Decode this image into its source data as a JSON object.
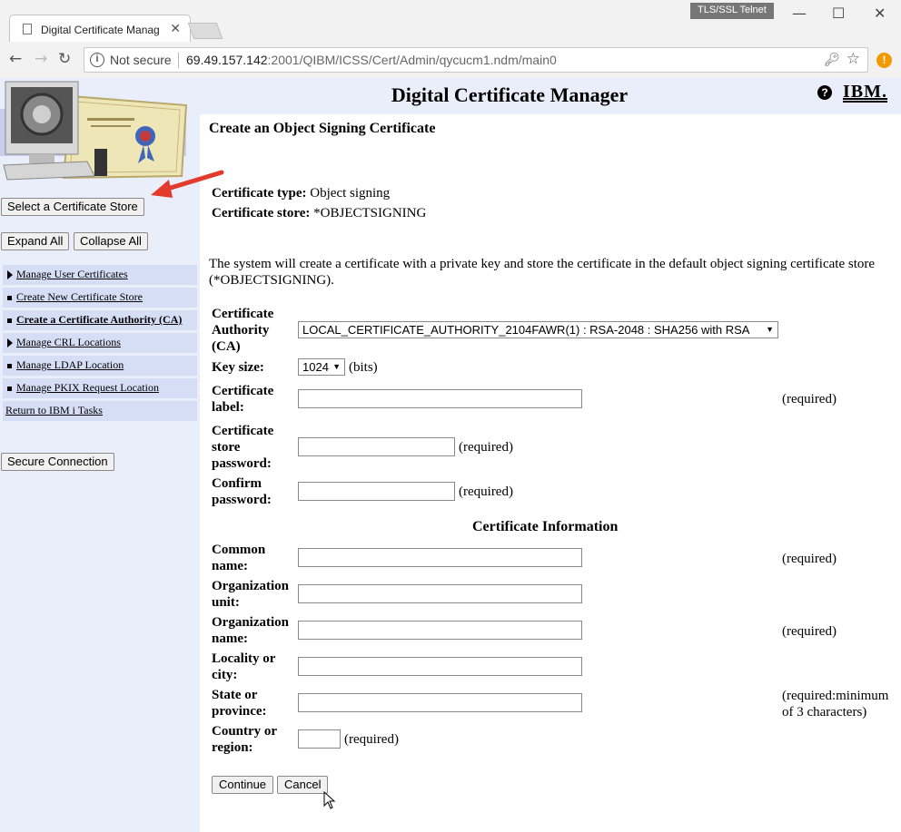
{
  "browser": {
    "tab_title": "Digital Certificate Manag",
    "tls_badge": "TLS/SSL Telnet",
    "security_label": "Not secure",
    "url_host": "69.49.157.142",
    "url_rest": ":2001/QIBM/ICSS/Cert/Admin/qycucm1.ndm/main0"
  },
  "header": {
    "app_title": "Digital Certificate Manager",
    "ibm_logo": "IBM."
  },
  "sidebar": {
    "select_store_button": "Select a Certificate Store",
    "expand_all": "Expand All",
    "collapse_all": "Collapse All",
    "items": [
      {
        "label": "Manage User Certificates",
        "marker": "triangle"
      },
      {
        "label": "Create New Certificate Store",
        "marker": "square"
      },
      {
        "label": "Create a Certificate Authority (CA)",
        "marker": "square",
        "active": true
      },
      {
        "label": "Manage CRL Locations",
        "marker": "triangle"
      },
      {
        "label": "Manage LDAP Location",
        "marker": "square"
      },
      {
        "label": "Manage PKIX Request Location",
        "marker": "square"
      },
      {
        "label": "Return to IBM i Tasks",
        "marker": "none"
      }
    ],
    "secure_connection": "Secure Connection"
  },
  "main": {
    "page_title": "Create an Object Signing Certificate",
    "cert_type_label": "Certificate type:",
    "cert_type_value": "Object signing",
    "cert_store_label": "Certificate store:",
    "cert_store_value": "*OBJECTSIGNING",
    "description": "The system will create a certificate with a private key and store the certificate in the default object signing certificate store (*OBJECTSIGNING).",
    "ca_label": "Certificate Authority (CA)",
    "ca_value": "LOCAL_CERTIFICATE_AUTHORITY_2104FAWR(1) : RSA-2048 : SHA256 with RSA",
    "keysize_label": "Key size:",
    "keysize_value": "1024",
    "keysize_unit": "(bits)",
    "label_label": "Certificate label:",
    "store_pw_label": "Certificate store password:",
    "confirm_pw_label": "Confirm password:",
    "section_title": "Certificate Information",
    "common_name_label": "Common name:",
    "org_unit_label": "Organization unit:",
    "org_name_label": "Organization name:",
    "locality_label": "Locality or city:",
    "state_label": "State or province:",
    "country_label": "Country or region:",
    "required": "(required)",
    "required_min3": "(required:minimum of 3 characters)",
    "continue_button": "Continue",
    "cancel_button": "Cancel"
  }
}
